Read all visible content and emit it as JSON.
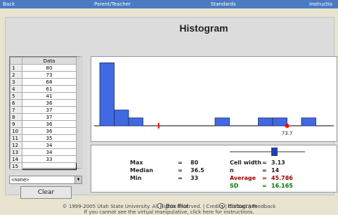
{
  "nav": {
    "back": "Back",
    "parent": "Parent/Teacher",
    "standards": "Standards",
    "instructions": "Instructio"
  },
  "title": "Histogram",
  "table": {
    "header": "Data",
    "rows": [
      {
        "index": "1",
        "value": "80"
      },
      {
        "index": "2",
        "value": "73"
      },
      {
        "index": "3",
        "value": "68"
      },
      {
        "index": "4",
        "value": "61"
      },
      {
        "index": "5",
        "value": "41"
      },
      {
        "index": "6",
        "value": "36"
      },
      {
        "index": "7",
        "value": "37"
      },
      {
        "index": "8",
        "value": "37"
      },
      {
        "index": "9",
        "value": "36"
      },
      {
        "index": "10",
        "value": "36"
      },
      {
        "index": "11",
        "value": "35"
      },
      {
        "index": "12",
        "value": "34"
      },
      {
        "index": "13",
        "value": "34"
      },
      {
        "index": "14",
        "value": "33"
      },
      {
        "index": "15",
        "value": ""
      }
    ]
  },
  "select": {
    "value": "<none>"
  },
  "clear_label": "Clear",
  "chart_data": {
    "type": "bar",
    "title": "",
    "xlabel": "",
    "ylabel": "",
    "bin_starts": [
      33,
      36.13,
      39.26,
      42.39,
      45.52,
      48.65,
      51.78,
      54.91,
      58.04,
      61.17,
      64.3,
      67.43,
      70.56,
      73.69,
      76.82
    ],
    "counts": [
      8,
      2,
      1,
      0,
      0,
      0,
      0,
      0,
      1,
      0,
      0,
      1,
      1,
      0,
      1
    ],
    "markers": [
      {
        "type": "mean",
        "value": 45.786,
        "color": "#ff0000"
      },
      {
        "type": "median",
        "value": 73.7,
        "label": "73.7",
        "color": "#ff0000"
      }
    ],
    "xlim": [
      33,
      83.08
    ],
    "ylim": [
      0,
      9
    ],
    "bar_color": "#4169e1"
  },
  "stats": {
    "max_label": "Max",
    "max_value": "80",
    "median_label": "Median",
    "median_value": "36.5",
    "min_label": "Min",
    "min_value": "33",
    "cellwidth_label": "Cell width",
    "cellwidth_value": "3.13",
    "n_label": "n",
    "n_value": "14",
    "average_label": "Average",
    "average_value": "45.786",
    "sd_label": "SD",
    "sd_value": "16.165",
    "eq": "=",
    "average_color": "#990000",
    "sd_color": "#007700"
  },
  "radios": {
    "boxplot": {
      "label": "Box Plot",
      "checked": false
    },
    "histogram": {
      "label": "Histogram",
      "checked": true
    }
  },
  "footer": {
    "line1": "© 1999-2005 Utah State University. All Rights Reserved. | Credits | Contact | Feedback",
    "line2": "If you cannot see the virtual manipulative, click here for instructions."
  }
}
